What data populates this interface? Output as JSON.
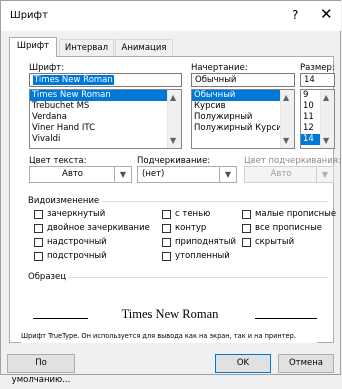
{
  "window": {
    "title": "Шрифт",
    "help_glyph": "?",
    "close_glyph": "✕"
  },
  "tabs": [
    {
      "label": "Шрифт",
      "active": true
    },
    {
      "label": "Интервал",
      "active": false
    },
    {
      "label": "Анимация",
      "active": false
    }
  ],
  "font": {
    "label": "Шрифт:",
    "value": "Times New Roman",
    "options": [
      "Times New Roman",
      "Trebuchet MS",
      "Verdana",
      "Viner Hand ITC",
      "Vivaldi"
    ],
    "selected": "Times New Roman"
  },
  "style": {
    "label": "Начертание:",
    "value": "Обычный",
    "options": [
      "Обычный",
      "Курсив",
      "Полужирный",
      "Полужирный Курсив"
    ],
    "selected": "Обычный"
  },
  "size": {
    "label": "Размер:",
    "value": "14",
    "options": [
      "9",
      "10",
      "11",
      "12",
      "14"
    ],
    "selected": "14"
  },
  "color": {
    "label": "Цвет текста:",
    "value": "Авто"
  },
  "underline": {
    "label": "Подчеркивание:",
    "value": "(нет)"
  },
  "underline_color": {
    "label": "Цвет подчеркивания:",
    "value": "Авто"
  },
  "effects": {
    "title": "Видоизменение",
    "items": [
      {
        "label": "зачеркнутый",
        "checked": false
      },
      {
        "label": "двойное зачеркивание",
        "checked": false
      },
      {
        "label": "надстрочный",
        "checked": false
      },
      {
        "label": "подстрочный",
        "checked": false
      },
      {
        "label": "с тенью",
        "checked": false
      },
      {
        "label": "контур",
        "checked": false
      },
      {
        "label": "приподнятый",
        "checked": false
      },
      {
        "label": "утопленный",
        "checked": false
      },
      {
        "label": "малые прописные",
        "checked": false
      },
      {
        "label": "все прописные",
        "checked": false
      },
      {
        "label": "скрытый",
        "checked": false
      }
    ]
  },
  "preview": {
    "title": "Образец",
    "text": "Times New Roman",
    "note": "Шрифт TrueType. Он используется для вывода как на экран, так и на принтер."
  },
  "buttons": {
    "default": "По умолчанию...",
    "ok": "OK",
    "cancel": "Отмена"
  }
}
